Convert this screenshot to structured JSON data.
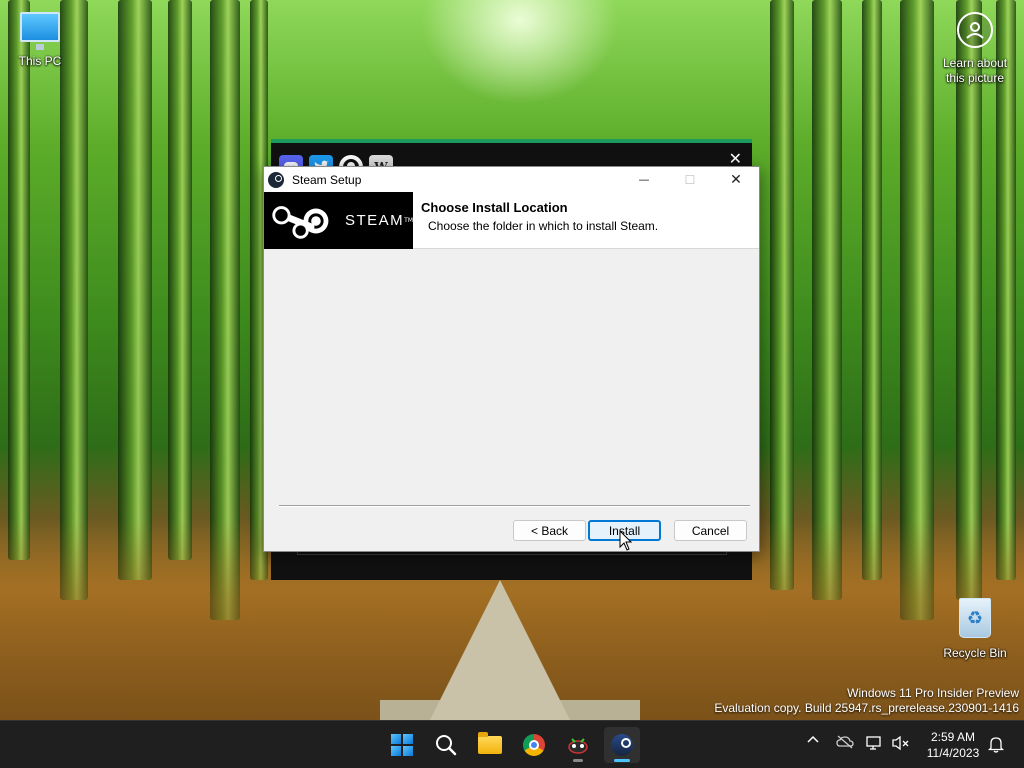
{
  "desktop": {
    "icons": {
      "this_pc": "This PC",
      "recycle_bin": "Recycle Bin",
      "learn_line1": "Learn about",
      "learn_line2": "this picture"
    },
    "watermark_line1": "Windows 11 Pro Insider Preview",
    "watermark_line2": "Evaluation copy. Build 25947.rs_prerelease.230901-1416"
  },
  "background_window": {
    "icons": [
      "discord-icon",
      "twitter-icon",
      "github-icon",
      "wikipedia-icon"
    ],
    "wiki_glyph": "W",
    "close_glyph": "✕",
    "accent": "#1d9a5e"
  },
  "dialog": {
    "title": "Steam Setup",
    "controls": {
      "minimize": "—",
      "maximize": "☐",
      "close": "✕"
    },
    "logo_text": "STEAM",
    "logo_tm": "TM",
    "header_title": "Choose Install Location",
    "header_subtitle": "Choose the folder in which to install Steam.",
    "buttons": {
      "back": "< Back",
      "install": "Install",
      "cancel": "Cancel"
    },
    "accent": "#0078d4"
  },
  "taskbar": {
    "apps": [
      "start-button",
      "search-button",
      "file-explorer",
      "chrome",
      "game-app",
      "steam"
    ],
    "tray_chevron": "^",
    "clock_time": "2:59 AM",
    "clock_date": "11/4/2023"
  }
}
